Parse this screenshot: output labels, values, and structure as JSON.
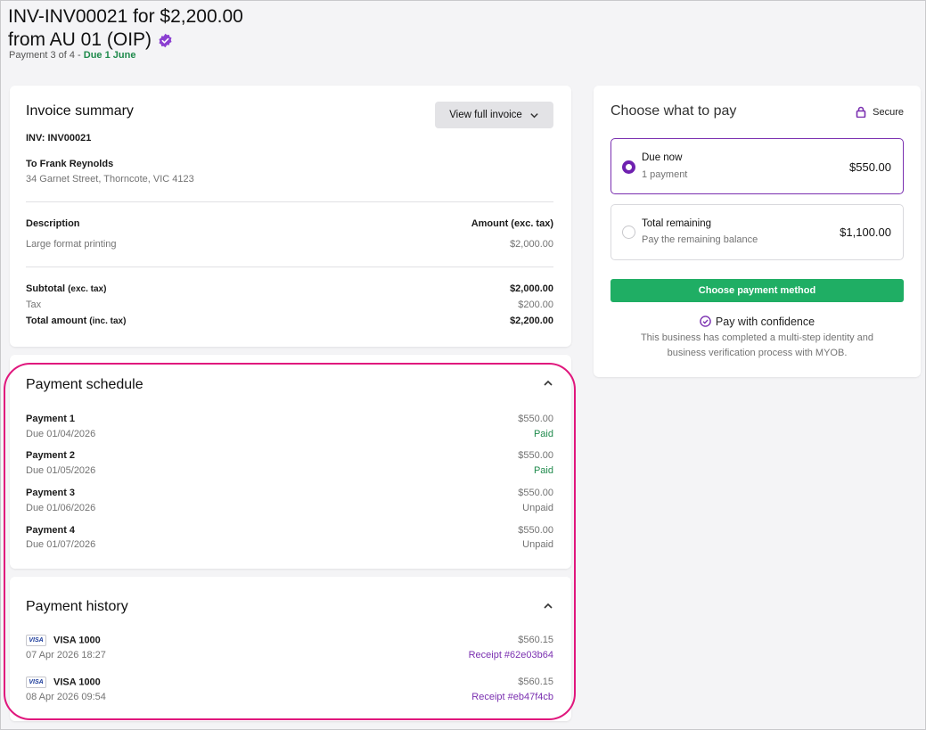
{
  "header": {
    "title_line1": "INV-INV00021 for $2,200.00",
    "title_line2": "from AU 01 (OIP)",
    "subtitle_prefix": "Payment 3 of 4 - ",
    "subtitle_due": "Due 1 June"
  },
  "invoice_summary": {
    "heading": "Invoice summary",
    "view_button": "View full invoice",
    "inv_label": "INV: INV00021",
    "to_label": "To Frank Reynolds",
    "address": "34 Garnet Street, Thorncote, VIC 4123",
    "description_header": "Description",
    "amount_header": "Amount (exc. tax)",
    "line_item": "Large format printing",
    "line_amount": "$2,000.00",
    "subtotal_label": "Subtotal",
    "subtotal_qual": "(exc. tax)",
    "subtotal_value": "$2,000.00",
    "tax_label": "Tax",
    "tax_value": "$200.00",
    "total_label": "Total amount",
    "total_qual": "(inc. tax)",
    "total_value": "$2,200.00"
  },
  "payment_schedule": {
    "heading": "Payment schedule",
    "items": [
      {
        "name": "Payment 1",
        "due": "Due 01/04/2026",
        "amount": "$550.00",
        "status": "Paid"
      },
      {
        "name": "Payment 2",
        "due": "Due 01/05/2026",
        "amount": "$550.00",
        "status": "Paid"
      },
      {
        "name": "Payment 3",
        "due": "Due 01/06/2026",
        "amount": "$550.00",
        "status": "Unpaid"
      },
      {
        "name": "Payment 4",
        "due": "Due 01/07/2026",
        "amount": "$550.00",
        "status": "Unpaid"
      }
    ]
  },
  "payment_history": {
    "heading": "Payment history",
    "card_brand": "VISA",
    "items": [
      {
        "card": "VISA 1000",
        "datetime": "07 Apr 2026 18:27",
        "amount": "$560.15",
        "receipt": "Receipt #62e03b64"
      },
      {
        "card": "VISA 1000",
        "datetime": "08 Apr 2026 09:54",
        "amount": "$560.15",
        "receipt": "Receipt #eb47f4cb"
      }
    ]
  },
  "pay_panel": {
    "heading": "Choose what to pay",
    "secure_label": "Secure",
    "options": [
      {
        "title": "Due now",
        "sub": "1 payment",
        "amount": "$550.00",
        "selected": true
      },
      {
        "title": "Total remaining",
        "sub": "Pay the remaining balance",
        "amount": "$1,100.00",
        "selected": false
      }
    ],
    "cta": "Choose payment method",
    "confidence_title": "Pay with confidence",
    "confidence_line1": "This business has completed a multi-step identity and",
    "confidence_line2": "business verification process with MYOB."
  },
  "colors": {
    "accent_purple": "#7a2fb0",
    "cta_green": "#1fae64",
    "paid_green": "#1f8a4c",
    "highlight_pink": "#e0177d"
  }
}
